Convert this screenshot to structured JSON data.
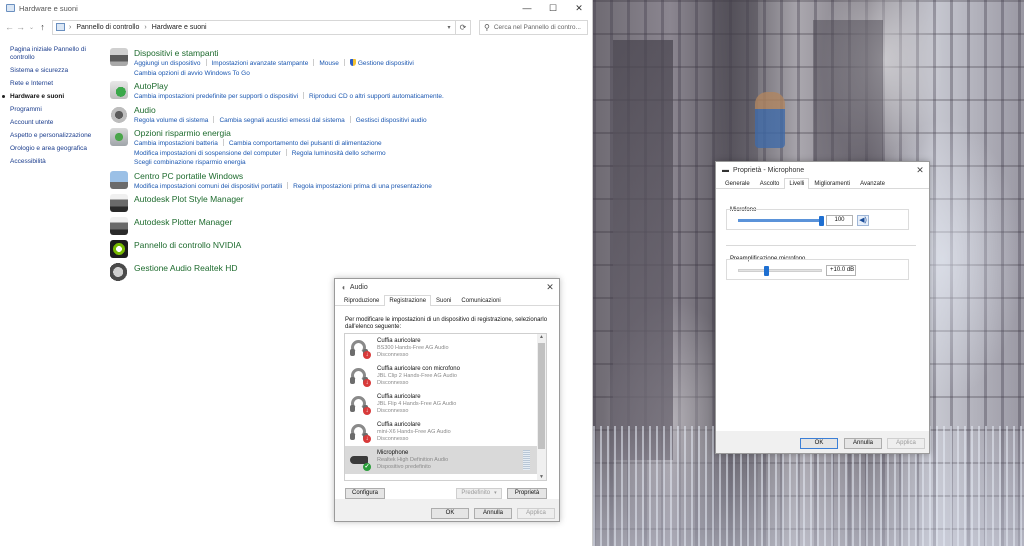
{
  "control_panel": {
    "window_title": "Hardware e suoni",
    "breadcrumb": [
      "Pannello di controllo",
      "Hardware e suoni"
    ],
    "search_placeholder": "Cerca nel Pannello di contro...",
    "left_nav": [
      "Pagina iniziale Pannello di controllo",
      "Sistema e sicurezza",
      "Rete e Internet",
      "Hardware e suoni",
      "Programmi",
      "Account utente",
      "Aspetto e personalizzazione",
      "Orologio e area geografica",
      "Accessibilità"
    ],
    "categories": [
      {
        "title": "Dispositivi e stampanti",
        "icon": "printer-icon",
        "links": [
          [
            "Aggiungi un dispositivo",
            "Impostazioni avanzate stampante",
            "Mouse",
            "Gestione dispositivi"
          ],
          [
            "Cambia opzioni di avvio Windows To Go"
          ]
        ]
      },
      {
        "title": "AutoPlay",
        "icon": "autoplay-icon",
        "links": [
          [
            "Cambia impostazioni predefinite per supporti o dispositivi",
            "Riproduci CD o altri supporti automaticamente."
          ]
        ]
      },
      {
        "title": "Audio",
        "icon": "speaker-icon",
        "links": [
          [
            "Regola volume di sistema",
            "Cambia segnali acustici emessi dal sistema",
            "Gestisci dispositivi audio"
          ]
        ]
      },
      {
        "title": "Opzioni risparmio energia",
        "icon": "battery-icon",
        "links": [
          [
            "Cambia impostazioni batteria",
            "Cambia comportamento dei pulsanti di alimentazione"
          ],
          [
            "Modifica impostazioni di sospensione del computer",
            "Regola luminosità dello schermo"
          ],
          [
            "Scegli combinazione risparmio energia"
          ]
        ]
      },
      {
        "title": "Centro PC portatile Windows",
        "icon": "mobility-center-icon",
        "links": [
          [
            "Modifica impostazioni comuni dei dispositivi portatili",
            "Regola impostazioni prima di una presentazione"
          ]
        ]
      },
      {
        "title": "Autodesk Plot Style Manager",
        "icon": "autodesk-plot-style-icon",
        "links": []
      },
      {
        "title": "Autodesk Plotter Manager",
        "icon": "autodesk-plotter-icon",
        "links": []
      },
      {
        "title": "Pannello di controllo NVIDIA",
        "icon": "nvidia-icon",
        "links": []
      },
      {
        "title": "Gestione Audio Realtek HD",
        "icon": "realtek-audio-icon",
        "links": []
      }
    ]
  },
  "audio_dialog": {
    "title": "Audio",
    "tabs": [
      "Riproduzione",
      "Registrazione",
      "Suoni",
      "Comunicazioni"
    ],
    "active_tab": 1,
    "instructions": "Per modificare le impostazioni di un dispositivo di registrazione, selezionarlo dall'elenco seguente:",
    "devices": [
      {
        "name": "Cuffia auricolare",
        "desc": "BS300 Hands-Free AG Audio",
        "status": "Disconnesso",
        "type": "headset",
        "badge": "disconnected"
      },
      {
        "name": "Cuffia auricolare con microfono",
        "desc": "JBL Clip 2 Hands-Free AG Audio",
        "status": "Disconnesso",
        "type": "headset",
        "badge": "disconnected"
      },
      {
        "name": "Cuffia auricolare",
        "desc": "JBL Flip 4 Hands-Free AG Audio",
        "status": "Disconnesso",
        "type": "headset",
        "badge": "disconnected"
      },
      {
        "name": "Cuffia auricolare",
        "desc": "mini-X6 Hands-Free AG Audio",
        "status": "Disconnesso",
        "type": "headset",
        "badge": "disconnected"
      },
      {
        "name": "Microphone",
        "desc": "Realtek High Definition Audio",
        "status": "Dispositivo predefinito",
        "type": "microphone",
        "badge": "default",
        "selected": true
      }
    ],
    "buttons": {
      "configure": "Configura",
      "set_default": "Predefinito",
      "properties": "Proprietà",
      "ok": "OK",
      "cancel": "Annulla",
      "apply": "Applica"
    }
  },
  "mic_dialog": {
    "title": "Proprietà - Microphone",
    "tabs": [
      "Generale",
      "Ascolto",
      "Livelli",
      "Miglioramenti",
      "Avanzate"
    ],
    "active_tab": 2,
    "microphone_label": "Microfono",
    "microphone_value": "100",
    "microphone_level": 100,
    "boost_label": "Preamplificazione microfono",
    "boost_value": "+10.0 dB",
    "boost_level": 0.33,
    "buttons": {
      "ok": "OK",
      "cancel": "Annulla",
      "apply": "Applica"
    }
  }
}
